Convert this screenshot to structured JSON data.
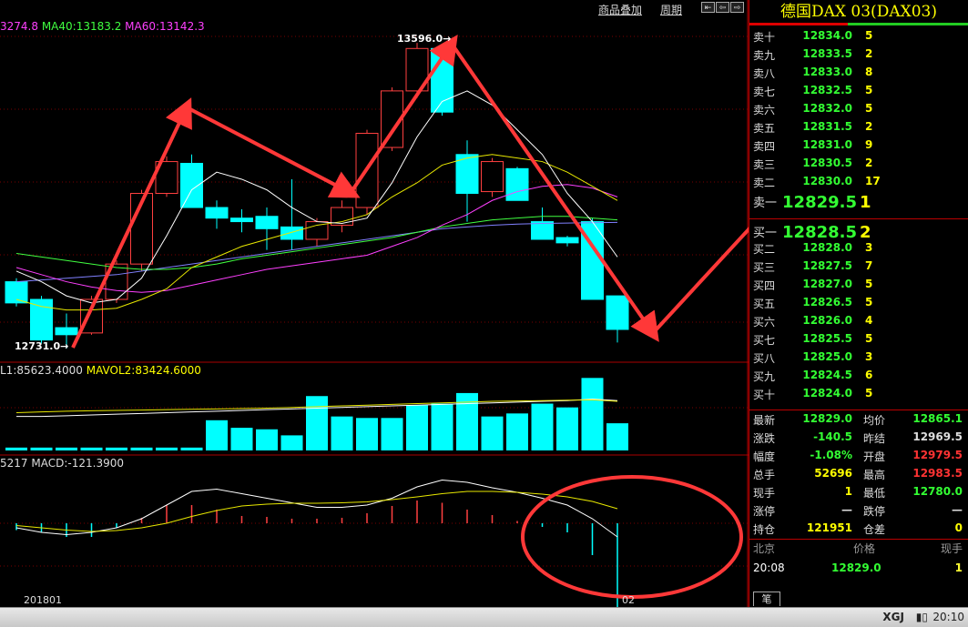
{
  "toolbar": {
    "overlay_label": "商品叠加",
    "period_label": "周期"
  },
  "indicators": {
    "ma_prefix": "3274.8",
    "ma40": "MA40:13183.2",
    "ma60": "MA60:13142.3",
    "vol_prefix": "L1:85623.4000",
    "mavol2": "MAVOL2:83424.6000",
    "macd_prefix": "5217",
    "macd": "MACD:-121.3900"
  },
  "annotations": {
    "high_label": "13596.0",
    "low_label": "12731.0"
  },
  "dates": {
    "d1": "201801",
    "d2": "02"
  },
  "colors": {
    "bull_body": "#000000",
    "bull_border": "#ff4040",
    "bear": "#00ffff",
    "arrow": "#ff3838",
    "ma_white": "#ffffff",
    "ma_yellow": "#e8e800",
    "ma_magenta": "#ff40ff",
    "ma_green": "#40ff40",
    "ma_blue": "#8080ff"
  },
  "chart_data": {
    "type": "candlestick",
    "y_axis": {
      "min": 12700,
      "max": 13640
    },
    "candles": [
      {
        "o": 12920,
        "h": 12930,
        "l": 12850,
        "c": 12860
      },
      {
        "o": 12870,
        "h": 12880,
        "l": 12745,
        "c": 12755
      },
      {
        "o": 12790,
        "h": 12830,
        "l": 12731,
        "c": 12770
      },
      {
        "o": 12775,
        "h": 12880,
        "l": 12770,
        "c": 12870
      },
      {
        "o": 12870,
        "h": 12980,
        "l": 12860,
        "c": 12970
      },
      {
        "o": 12970,
        "h": 13180,
        "l": 12950,
        "c": 13170
      },
      {
        "o": 13170,
        "h": 13275,
        "l": 13160,
        "c": 13260
      },
      {
        "o": 13255,
        "h": 13280,
        "l": 13130,
        "c": 13130
      },
      {
        "o": 13130,
        "h": 13150,
        "l": 13070,
        "c": 13100
      },
      {
        "o": 13100,
        "h": 13125,
        "l": 13060,
        "c": 13090
      },
      {
        "o": 13105,
        "h": 13130,
        "l": 13010,
        "c": 13070
      },
      {
        "o": 13075,
        "h": 13210,
        "l": 13010,
        "c": 13040
      },
      {
        "o": 13040,
        "h": 13100,
        "l": 13020,
        "c": 13090
      },
      {
        "o": 13080,
        "h": 13150,
        "l": 13060,
        "c": 13130
      },
      {
        "o": 13130,
        "h": 13350,
        "l": 13110,
        "c": 13340
      },
      {
        "o": 13300,
        "h": 13470,
        "l": 13290,
        "c": 13460
      },
      {
        "o": 13460,
        "h": 13596,
        "l": 13440,
        "c": 13580
      },
      {
        "o": 13580,
        "h": 13590,
        "l": 13390,
        "c": 13400
      },
      {
        "o": 13280,
        "h": 13320,
        "l": 13090,
        "c": 13170
      },
      {
        "o": 13175,
        "h": 13270,
        "l": 13160,
        "c": 13260
      },
      {
        "o": 13240,
        "h": 13245,
        "l": 13160,
        "c": 13150
      },
      {
        "o": 13090,
        "h": 13130,
        "l": 13040,
        "c": 13040
      },
      {
        "o": 13045,
        "h": 13050,
        "l": 13020,
        "c": 13030
      },
      {
        "o": 13090,
        "h": 13100,
        "l": 12870,
        "c": 12870
      },
      {
        "o": 12880,
        "h": 12880,
        "l": 12748,
        "c": 12785
      }
    ],
    "ma_white": [
      12950,
      12920,
      12880,
      12860,
      12870,
      12930,
      13050,
      13180,
      13230,
      13210,
      13180,
      13130,
      13090,
      13085,
      13100,
      13200,
      13330,
      13430,
      13460,
      13420,
      13350,
      13280,
      13170,
      13090,
      12990
    ],
    "ma_yellow": [
      12870,
      12850,
      12840,
      12840,
      12845,
      12870,
      12900,
      12960,
      12990,
      13020,
      13040,
      13060,
      13080,
      13090,
      13110,
      13160,
      13200,
      13250,
      13270,
      13280,
      13270,
      13260,
      13230,
      13190,
      13150
    ],
    "ma_magenta": [
      12960,
      12940,
      12920,
      12905,
      12895,
      12890,
      12895,
      12910,
      12925,
      12940,
      12955,
      12965,
      12975,
      12985,
      12995,
      13020,
      13045,
      13080,
      13110,
      13150,
      13175,
      13190,
      13195,
      13185,
      13160
    ],
    "ma_green": [
      13000,
      12990,
      12980,
      12970,
      12960,
      12955,
      12955,
      12960,
      12970,
      12985,
      12995,
      13005,
      13015,
      13025,
      13035,
      13045,
      13060,
      13075,
      13085,
      13095,
      13100,
      13105,
      13105,
      13100,
      13095
    ],
    "ma_blue": [
      12920,
      12925,
      12930,
      12935,
      12940,
      12950,
      12960,
      12970,
      12980,
      12990,
      13000,
      13010,
      13020,
      13030,
      13040,
      13050,
      13060,
      13070,
      13075,
      13080,
      13083,
      13085,
      13086,
      13087,
      13088
    ],
    "volume": {
      "min": 0,
      "max": 100000,
      "values": [
        3800,
        3800,
        3800,
        3800,
        3800,
        3800,
        3800,
        3800,
        40000,
        30000,
        28000,
        20000,
        72000,
        45000,
        43000,
        43000,
        60000,
        62000,
        76000,
        45000,
        49000,
        62000,
        57000,
        96000,
        36000
      ],
      "bull": [
        false,
        false,
        false,
        false,
        false,
        false,
        false,
        false,
        false,
        false,
        false,
        false,
        false,
        false,
        false,
        false,
        false,
        false,
        false,
        false,
        false,
        false,
        false,
        false,
        false
      ]
    },
    "volume_ma_a": [
      45000,
      45000,
      46000,
      47000,
      48000,
      49000,
      50000,
      51000,
      52000,
      53000,
      54000,
      55000,
      56000,
      57000,
      58000,
      59000,
      60000,
      61000,
      62000,
      63000,
      64000,
      65000,
      66000,
      68000,
      66000
    ],
    "volume_ma_b": [
      50000,
      51000,
      52000,
      52500,
      53000,
      53500,
      54000,
      54500,
      55000,
      55500,
      56000,
      57000,
      58000,
      59000,
      60000,
      61000,
      62000,
      63000,
      64000,
      65000,
      65500,
      66000,
      66500,
      67000,
      65000
    ],
    "macd": {
      "min": -200,
      "max": 120,
      "hist": [
        -15,
        -20,
        -30,
        -30,
        -10,
        12,
        40,
        40,
        30,
        16,
        14,
        10,
        10,
        12,
        22,
        38,
        50,
        45,
        30,
        18,
        5,
        -8,
        -20,
        -70,
        -200
      ],
      "dif": [
        -10,
        -20,
        -25,
        -20,
        -10,
        10,
        40,
        70,
        75,
        65,
        55,
        45,
        35,
        35,
        40,
        55,
        80,
        95,
        90,
        78,
        68,
        55,
        40,
        10,
        -30
      ],
      "dea": [
        -5,
        -10,
        -15,
        -18,
        -16,
        -10,
        0,
        15,
        28,
        38,
        42,
        44,
        44,
        45,
        47,
        52,
        58,
        65,
        70,
        70,
        68,
        64,
        58,
        48,
        32
      ]
    }
  },
  "orderbook": {
    "title": "德国DAX 03(DAX03)",
    "asks": [
      {
        "label": "卖十",
        "price": "12834.0",
        "vol": "5"
      },
      {
        "label": "卖九",
        "price": "12833.5",
        "vol": "2"
      },
      {
        "label": "卖八",
        "price": "12833.0",
        "vol": "8"
      },
      {
        "label": "卖七",
        "price": "12832.5",
        "vol": "5"
      },
      {
        "label": "卖六",
        "price": "12832.0",
        "vol": "5"
      },
      {
        "label": "卖五",
        "price": "12831.5",
        "vol": "2"
      },
      {
        "label": "卖四",
        "price": "12831.0",
        "vol": "9"
      },
      {
        "label": "卖三",
        "price": "12830.5",
        "vol": "2"
      },
      {
        "label": "卖二",
        "price": "12830.0",
        "vol": "17"
      },
      {
        "label": "卖一",
        "price": "12829.5",
        "vol": "1"
      }
    ],
    "bids": [
      {
        "label": "买一",
        "price": "12828.5",
        "vol": "2"
      },
      {
        "label": "买二",
        "price": "12828.0",
        "vol": "3"
      },
      {
        "label": "买三",
        "price": "12827.5",
        "vol": "7"
      },
      {
        "label": "买四",
        "price": "12827.0",
        "vol": "5"
      },
      {
        "label": "买五",
        "price": "12826.5",
        "vol": "5"
      },
      {
        "label": "买六",
        "price": "12826.0",
        "vol": "4"
      },
      {
        "label": "买七",
        "price": "12825.5",
        "vol": "5"
      },
      {
        "label": "买八",
        "price": "12825.0",
        "vol": "3"
      },
      {
        "label": "买九",
        "price": "12824.5",
        "vol": "6"
      },
      {
        "label": "买十",
        "price": "12824.0",
        "vol": "5"
      }
    ]
  },
  "stats": [
    {
      "l1": "最新",
      "v1": "12829.0",
      "c1": "#3f3",
      "l2": "均价",
      "v2": "12865.1",
      "c2": "#3f3"
    },
    {
      "l1": "涨跌",
      "v1": "-140.5",
      "c1": "#3f3",
      "l2": "昨结",
      "v2": "12969.5",
      "c2": "#ddd"
    },
    {
      "l1": "幅度",
      "v1": "-1.08%",
      "c1": "#3f3",
      "l2": "开盘",
      "v2": "12979.5",
      "c2": "#f33"
    },
    {
      "l1": "总手",
      "v1": "52696",
      "c1": "#ff0",
      "l2": "最高",
      "v2": "12983.5",
      "c2": "#f33"
    },
    {
      "l1": "现手",
      "v1": "1",
      "c1": "#ff0",
      "l2": "最低",
      "v2": "12780.0",
      "c2": "#3f3"
    },
    {
      "l1": "涨停",
      "v1": "—",
      "c1": "#ddd",
      "l2": "跌停",
      "v2": "—",
      "c2": "#ddd"
    },
    {
      "l1": "持仓",
      "v1": "121951",
      "c1": "#ff0",
      "l2": "仓差",
      "v2": "0",
      "c2": "#ff0"
    }
  ],
  "ticks": {
    "headers": {
      "place": "北京",
      "price": "价格",
      "qty": "现手"
    },
    "row": {
      "time": "20:08",
      "price": "12829.0",
      "qty": "1"
    },
    "tab": "笔"
  },
  "statusbar": {
    "brand": "XGJ",
    "time": "20:10"
  }
}
